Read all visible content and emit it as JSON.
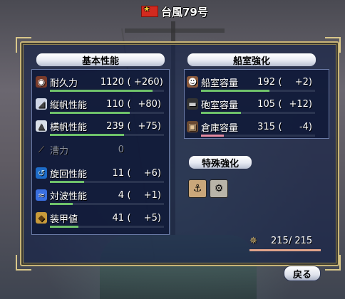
{
  "title": {
    "ship_name": "台風79号"
  },
  "basic": {
    "header": "基本性能",
    "rows": [
      {
        "label": "耐久力",
        "value": "1120",
        "paren": "(",
        "delta": "+260)",
        "fill_pct": 0.9,
        "fill_color": "#6fc26a"
      },
      {
        "label": "縦帆性能",
        "value": "110",
        "paren": "(",
        "delta": "+80)",
        "fill_pct": 0.7,
        "fill_color": "#6fc26a"
      },
      {
        "label": "横帆性能",
        "value": "239",
        "paren": "(",
        "delta": "+75)",
        "fill_pct": 0.65,
        "fill_color": "#6fc26a"
      },
      {
        "label": "漕力",
        "value": "0",
        "paren": "",
        "delta": "",
        "fill_pct": 0,
        "fill_color": "#6fc26a"
      },
      {
        "label": "旋回性能",
        "value": "11",
        "paren": "(",
        "delta": "+6)",
        "fill_pct": 0.3,
        "fill_color": "#6fc26a"
      },
      {
        "label": "対波性能",
        "value": "4",
        "paren": "(",
        "delta": "+1)",
        "fill_pct": 0.2,
        "fill_color": "#6fc26a"
      },
      {
        "label": "装甲値",
        "value": "41",
        "paren": "(",
        "delta": "+5)",
        "fill_pct": 0.25,
        "fill_color": "#6fc26a"
      }
    ]
  },
  "cabin": {
    "header": "船室強化",
    "rows": [
      {
        "label": "船室容量",
        "value": "192",
        "paren": "(",
        "delta": "+2)",
        "fill_pct": 0.6,
        "fill_color": "#6fc26a"
      },
      {
        "label": "砲室容量",
        "value": "105",
        "paren": "(",
        "delta": "+12)",
        "fill_pct": 0.35,
        "fill_color": "#6fc26a"
      },
      {
        "label": "倉庫容量",
        "value": "315",
        "paren": "(",
        "delta": "-4)",
        "fill_pct": 0.2,
        "fill_color": "#e48aa0"
      }
    ]
  },
  "special": {
    "header": "特殊強化"
  },
  "crew": {
    "value": "215/ 215"
  },
  "back_button": {
    "label": "戻る"
  },
  "icons": {
    "basic": [
      "durability-icon",
      "fore-aft-sail-icon",
      "square-sail-icon",
      "oar-icon",
      "turning-icon",
      "wave-icon",
      "armor-icon"
    ],
    "cabin": [
      "crew-cabin-icon",
      "cannon-icon",
      "storage-icon"
    ],
    "special": [
      "special-upgrade-1-icon",
      "special-upgrade-2-icon"
    ],
    "crew": "helm-icon",
    "flag": "flag-icon"
  },
  "colors": {
    "accent_gold": "#c8b578",
    "bar_green": "#6fc26a",
    "bar_pink": "#e48aa0"
  }
}
